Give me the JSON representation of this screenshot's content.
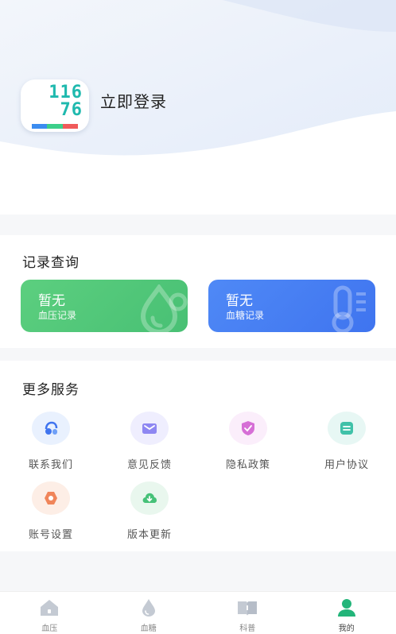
{
  "colors": {
    "accent_green": "#48c074",
    "accent_blue": "#3f74ef",
    "tab_active": "#23b57a",
    "tab_inactive": "#c4cad3"
  },
  "header": {
    "avatar_reading_top": "116",
    "avatar_reading_bottom": "76",
    "login_label": "立即登录"
  },
  "records": {
    "title": "记录查询",
    "cards": [
      {
        "value": "暂无",
        "label": "血压记录",
        "icon": "droplet-icon"
      },
      {
        "value": "暂无",
        "label": "血糖记录",
        "icon": "thermometer-icon"
      }
    ]
  },
  "services": {
    "title": "更多服务",
    "items": [
      {
        "label": "联系我们",
        "icon": "headset-icon",
        "bg": "#e9f1fe",
        "color": "#3f74ef"
      },
      {
        "label": "意见反馈",
        "icon": "mail-icon",
        "bg": "#efeefe",
        "color": "#8e87f2"
      },
      {
        "label": "隐私政策",
        "icon": "shield-icon",
        "bg": "#fbeefb",
        "color": "#d66fd6"
      },
      {
        "label": "用户协议",
        "icon": "document-icon",
        "bg": "#e7f7f4",
        "color": "#3fc1a8"
      },
      {
        "label": "账号设置",
        "icon": "gear-icon",
        "bg": "#fdeee6",
        "color": "#f0855a"
      },
      {
        "label": "版本更新",
        "icon": "cloud-download-icon",
        "bg": "#e9f7ee",
        "color": "#46c178"
      }
    ]
  },
  "tabs": [
    {
      "label": "血压",
      "icon": "home-icon",
      "active": false
    },
    {
      "label": "血糖",
      "icon": "drop-icon",
      "active": false
    },
    {
      "label": "科普",
      "icon": "book-icon",
      "active": false
    },
    {
      "label": "我的",
      "icon": "user-icon",
      "active": true
    }
  ]
}
